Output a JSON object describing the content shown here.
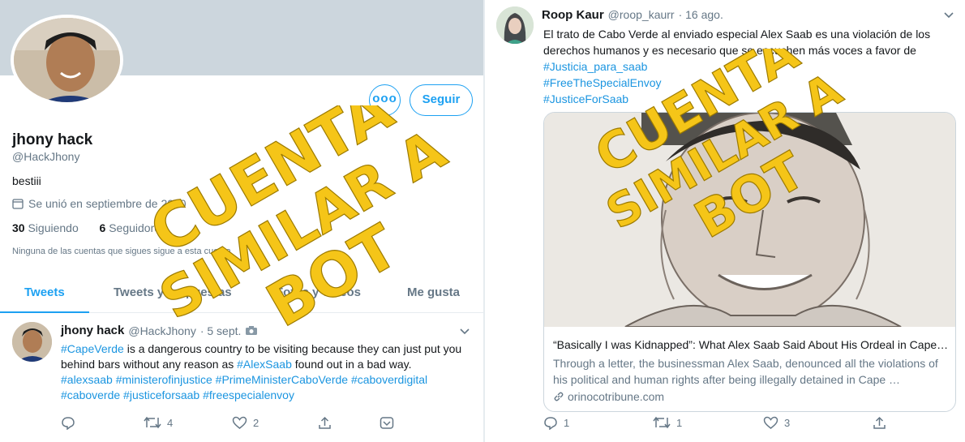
{
  "profile": {
    "name": "jhony hack",
    "handle": "@HackJhony",
    "bio": "bestiii",
    "joined": "Se unió en septiembre de 2020",
    "following_count": "30",
    "following_label": "Siguiendo",
    "followers_count": "6",
    "followers_label": "Seguidores",
    "followed_by_note": "Ninguna de las cuentas que sigues sigue a esta cuenta",
    "follow_button": "Seguir",
    "more_button": "ooo"
  },
  "tabs": [
    "Tweets",
    "Tweets y respuestas",
    "Fotos y videos",
    "Me gusta"
  ],
  "left_tweet": {
    "name": "jhony hack",
    "handle": "@HackJhony",
    "date": "· 5 sept.",
    "text_parts": [
      {
        "t": "#CapeVerde",
        "link": true
      },
      {
        "t": " is a dangerous country to be visiting because they can just put you behind bars without any reason as ",
        "link": false
      },
      {
        "t": "#AlexSaab",
        "link": true
      },
      {
        "t": " found out in a bad way.",
        "link": false
      }
    ],
    "hashtags": "#alexsaab #ministerofinjustice #PrimeMinisterCaboVerde  #caboverdigital #caboverde #justiceforsaab #freespecialenvoy",
    "retweets": "4",
    "likes": "2"
  },
  "right_tweet": {
    "name": "Roop Kaur",
    "handle": "@roop_kaurr",
    "date": "· 16 ago.",
    "text": "El trato de Cabo Verde al enviado especial Alex Saab es una violación de los derechos humanos y es necesario que se escuchen más voces a favor de",
    "hashtag_lines": [
      "#Justicia_para_saab",
      "#FreeTheSpecialEnvoy",
      "#JusticeForSaab"
    ],
    "card_title": "“Basically I was Kidnapped”: What Alex Saab Said About His Ordeal in Cape Verde",
    "card_desc": "Through a letter, the businessman Alex Saab, denounced all the violations of his political and human rights after being illegally detained in Cape …",
    "card_url": "orinocotribune.com",
    "replies": "1",
    "retweets": "1",
    "likes": "3"
  },
  "watermark": {
    "line1": "CUENTA",
    "line2": "SIMILAR A",
    "line3": "BOT",
    "color": "#f5c518"
  },
  "colors": {
    "accent": "#1da1f2",
    "link": "#1b95e0",
    "secondary_text": "#657786",
    "banner": "#ccd6dd"
  }
}
